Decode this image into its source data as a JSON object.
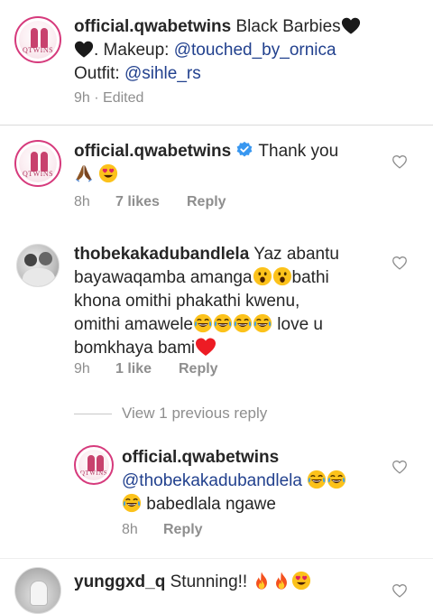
{
  "caption": {
    "username": "official.qwabetwins",
    "text_a": "Black Barbies",
    "text_b": ". Makeup: ",
    "mention_makeup": "@touched_by_ornica",
    "outfit_label": "Outfit: ",
    "mention_outfit": "@sihle_rs",
    "time": "9h",
    "edited": "· Edited"
  },
  "comments": [
    {
      "username": "official.qwabetwins",
      "verified": true,
      "text": "Thank you",
      "time": "8h",
      "likes": "7 likes",
      "reply": "Reply"
    },
    {
      "username": "thobekakadubandlela",
      "text_a": "Yaz abantu",
      "text_b": "bayawaqamba amanga",
      "text_c": "bathi",
      "text_d": "khona omithi phakathi kwenu,",
      "text_e": "omithi amawele",
      "text_f": "love u",
      "text_g": "bomkhaya bami",
      "time": "9h",
      "likes": "1 like",
      "reply": "Reply"
    }
  ],
  "view_previous": "View 1 previous reply",
  "reply": {
    "username": "official.qwabetwins",
    "mention": "@thobekakadubandlela",
    "text": "babedlala ngawe",
    "time": "8h",
    "reply": "Reply"
  },
  "last_comment": {
    "username": "yunggxd_q",
    "text": "Stunning!!"
  },
  "avatar_text": "QTWINS",
  "colors": {
    "mention": "#22418e",
    "meta": "#8e8e8e",
    "ring": "#d63a7c",
    "verified": "#3897f0",
    "heart_red": "#ed1c24"
  }
}
